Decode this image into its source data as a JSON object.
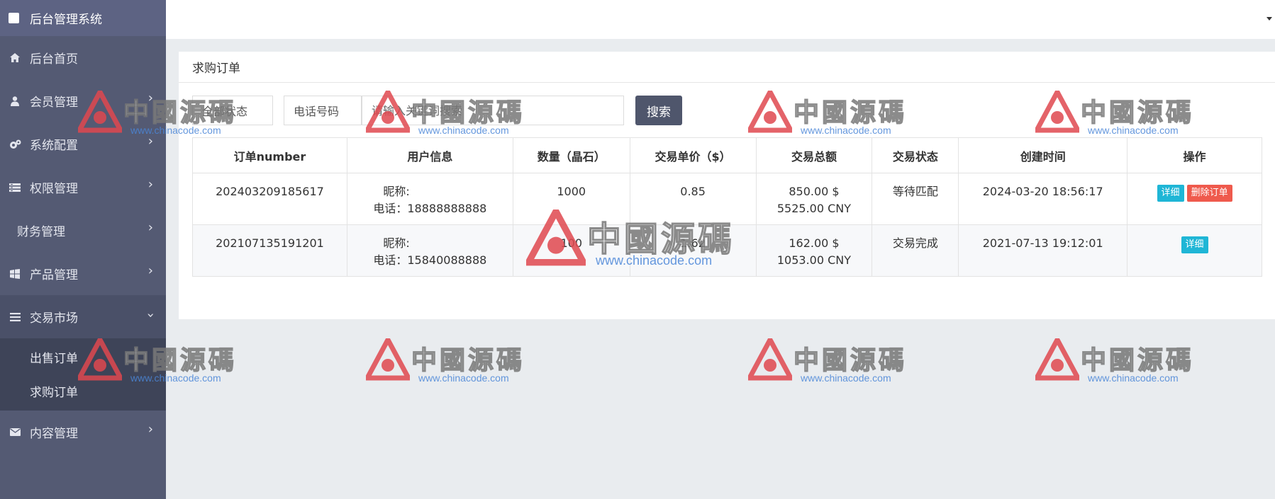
{
  "sidebar": {
    "brand": "后台管理系统",
    "items": [
      {
        "label": "后台首页",
        "icon": "home-icon",
        "has_children": false
      },
      {
        "label": "会员管理",
        "icon": "user-icon",
        "has_children": true
      },
      {
        "label": "系统配置",
        "icon": "cogs-icon",
        "has_children": true
      },
      {
        "label": "权限管理",
        "icon": "list-icon",
        "has_children": true
      },
      {
        "label": "财务管理",
        "icon": "",
        "has_children": true
      },
      {
        "label": "产品管理",
        "icon": "windows-icon",
        "has_children": true
      },
      {
        "label": "交易市场",
        "icon": "bars-icon",
        "has_children": true,
        "open": true
      },
      {
        "label": "内容管理",
        "icon": "envelope-icon",
        "has_children": true
      }
    ],
    "trade_submenu": [
      "出售订单",
      "求购订单"
    ]
  },
  "panel": {
    "title": "求购订单"
  },
  "filters": {
    "status_select": "全部状态",
    "field_select": "电话号码",
    "keyword_placeholder": "请输入关键词搜索",
    "search_label": "搜索"
  },
  "table": {
    "headers": [
      "订单number",
      "用户信息",
      "数量（晶石）",
      "交易单价（$）",
      "交易总额",
      "交易状态",
      "创建时间",
      "操作"
    ],
    "rows": [
      {
        "order_no": "202403209185617",
        "nickname": "昵称:",
        "phone": "电话：18888888888",
        "quantity": "1000",
        "unit_price": "0.85",
        "total_usd": "850.00 $",
        "total_cny": "5525.00 CNY",
        "status": "等待匹配",
        "created": "2024-03-20 18:56:17",
        "actions": [
          "详细",
          "删除订单"
        ]
      },
      {
        "order_no": "202107135191201",
        "nickname": "昵称:",
        "phone": "电话：15840088888",
        "quantity": "100",
        "unit_price": "1.62",
        "total_usd": "162.00 $",
        "total_cny": "1053.00 CNY",
        "status": "交易完成",
        "created": "2021-07-13 19:12:01",
        "actions": [
          "详细"
        ]
      }
    ]
  },
  "watermark": {
    "text": "中國源碼",
    "url": "www.chinacode.com",
    "logo_color": "#e0484f"
  },
  "colors": {
    "sidebar_bg": "#545a73",
    "search_button": "#4f566c",
    "info_button": "#1fb6d6",
    "danger_button": "#ef5a4d"
  }
}
